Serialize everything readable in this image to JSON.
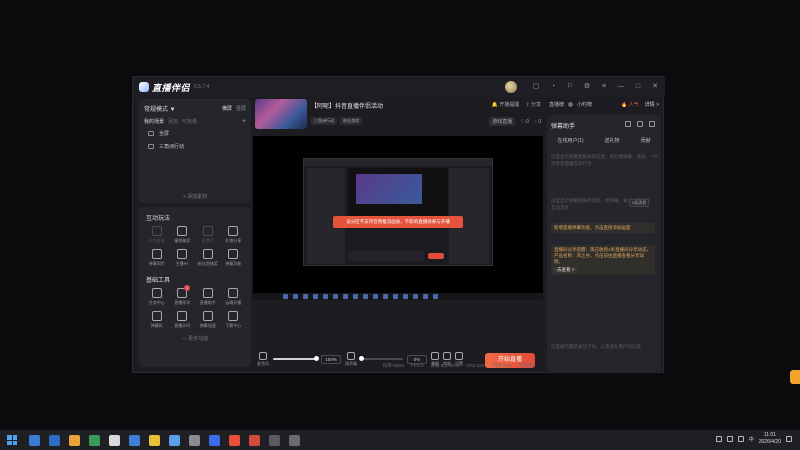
{
  "app": {
    "logo_text": "直播伴侣",
    "version": "6.5.7.4"
  },
  "left": {
    "mode": "常规模式 ▼",
    "mode_actions": [
      "横屏",
      "竖屏"
    ],
    "scene_title": "我的场景",
    "scene_tabs": [
      "添加",
      "可批量"
    ],
    "scene_items": [
      "全屏",
      "三角洲行动"
    ],
    "add_material": "+ 添加素材",
    "interact_title": "互动玩法",
    "interact_tools": [
      {
        "label": "在线连麦",
        "dim": true
      },
      {
        "label": "福袋抽奖",
        "dim": false
      },
      {
        "label": "直播间",
        "dim": true
      },
      {
        "label": "礼物分享",
        "dim": false
      },
      {
        "label": "弹幕同步",
        "dim": false
      },
      {
        "label": "主播PK",
        "dim": false
      },
      {
        "label": "粉丝团抽奖",
        "dim": false
      },
      {
        "label": "弹幕功能",
        "dim": false
      }
    ],
    "basic_title": "基础工具",
    "basic_tools": [
      {
        "label": "任务中心",
        "badge": ""
      },
      {
        "label": "直播伴学",
        "badge": "1"
      },
      {
        "label": "直播助手",
        "badge": ""
      },
      {
        "label": "云端开播",
        "badge": ""
      },
      {
        "label": "弹幕机",
        "badge": ""
      },
      {
        "label": "直播计时",
        "badge": ""
      },
      {
        "label": "弹幕加速",
        "badge": ""
      },
      {
        "label": "下载中心",
        "badge": ""
      }
    ],
    "more": "— 更多功能"
  },
  "center": {
    "room_title": "【阿呢】抖音直播伴侣活动",
    "tags": [
      "三角洲行动",
      "射击游戏"
    ],
    "actions": [
      "开播提醒",
      "分享"
    ],
    "meta_pill": "游戏直播",
    "likes": "0",
    "comments": "0",
    "toast": "该分区不支持音频推流画质，不影响直播效果与开播",
    "controls": {
      "mic_label": "麦克风",
      "mic_pct": "100%",
      "speaker_label": "扬声器",
      "speaker_pct": "0%",
      "beauty_label": "美颜",
      "effects_label": "特效",
      "settings_label": "设置"
    },
    "live_button": "开始直播",
    "status": [
      "码率:0kb/s",
      "FPS:0",
      "丢帧:0(0.00%)",
      "CPU:33%",
      "内存:44%",
      "未开播"
    ]
  },
  "right": {
    "head_items": [
      "直播榜",
      "小时榜"
    ],
    "rank": "人气",
    "detail": "详情 >",
    "dm_title": "弹幕助手",
    "dm_tabs": [
      "在线用户(1)",
      "送礼物",
      "贡献"
    ],
    "desc1": "这里显示观看者相关的信息，如礼物弹幕、进房、点赞等直播互动行为",
    "count": "0.0",
    "desc2": "这里显示弹幕相关的消息，如弹幕、关注、礼物等互动消息",
    "hint_btn": "0条消息",
    "notice1": "新增直播弹幕功能，点击直接添加画面",
    "notice2": "直播间分享提醒：现已收到1条直播间分享动态，产品名称：风之谷，点击前往直播查看分享详情。",
    "goto": "去查看 >",
    "desc3": "这里展示最新关注了你，以及送礼用户的信息"
  },
  "taskbar": {
    "time": "11:01",
    "date": "2026/4/20",
    "ime": "中",
    "icon_colors": [
      "#3a7bd5",
      "#2b6cc4",
      "#e8a33a",
      "#3a9a5a",
      "#d9d9d9",
      "#3f7fd6",
      "#e6c13a",
      "#5aa0e8",
      "#8a8a92",
      "#3a6ee8",
      "#e8503a",
      "#d24a3a",
      "#5a5a62",
      "#6a6a72"
    ]
  }
}
